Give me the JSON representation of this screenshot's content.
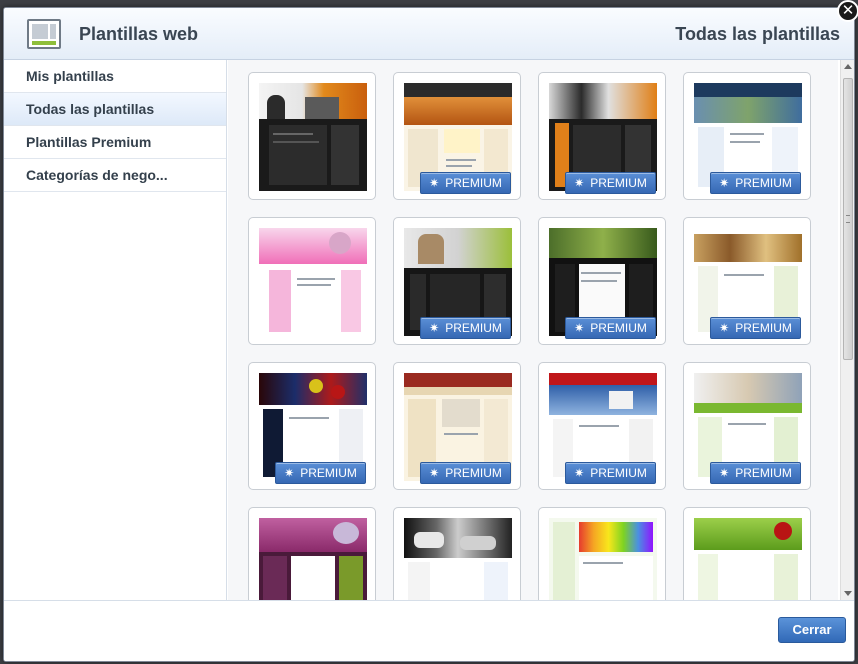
{
  "header": {
    "title": "Plantillas web",
    "section_title": "Todas las plantillas"
  },
  "close": {
    "glyph": "✕"
  },
  "sidebar": {
    "items": [
      {
        "label": "Mis plantillas",
        "active": false
      },
      {
        "label": "Todas las plantillas",
        "active": true
      },
      {
        "label": "Plantillas Premium",
        "active": false
      },
      {
        "label": "Categorías de nego...",
        "active": false
      }
    ]
  },
  "templates": {
    "premium_label": "PREMIUM",
    "premium_icon": "snowflake-icon",
    "rows": [
      [
        {
          "name": "template-business-orange",
          "premium": false
        },
        {
          "name": "template-city-skyline",
          "premium": true
        },
        {
          "name": "template-business-orange-2",
          "premium": true
        },
        {
          "name": "template-blue-nature",
          "premium": true
        }
      ],
      [
        {
          "name": "template-pink-travel",
          "premium": false
        },
        {
          "name": "template-dark-green",
          "premium": true
        },
        {
          "name": "template-dark-photos",
          "premium": true
        },
        {
          "name": "template-food-green",
          "premium": true
        }
      ],
      [
        {
          "name": "template-billiards",
          "premium": true
        },
        {
          "name": "template-beige-office",
          "premium": true
        },
        {
          "name": "template-red-sky",
          "premium": true
        },
        {
          "name": "template-green-people",
          "premium": true
        }
      ],
      [
        {
          "name": "template-purple-travel",
          "premium": false
        },
        {
          "name": "template-cars",
          "premium": false
        },
        {
          "name": "template-colored-hands",
          "premium": false
        },
        {
          "name": "template-apples",
          "premium": false
        }
      ]
    ]
  },
  "footer": {
    "close_label": "Cerrar"
  },
  "colors": {
    "accent": "#3a6fbc",
    "header_bg": "#e4edf8",
    "text": "#34404c"
  }
}
